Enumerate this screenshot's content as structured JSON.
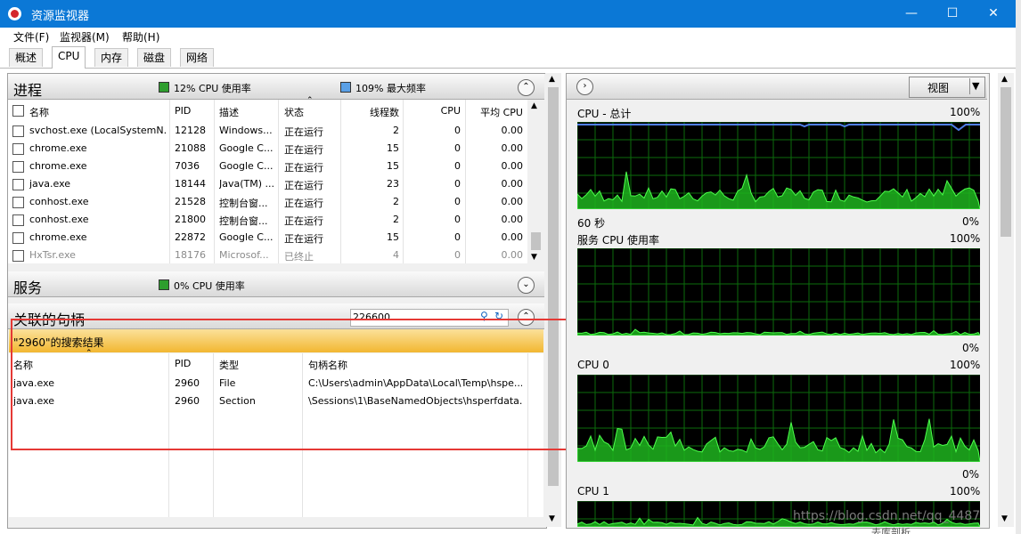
{
  "window": {
    "title": "资源监视器"
  },
  "menu": [
    {
      "label": "文件(F)"
    },
    {
      "label": "监视器(M)"
    },
    {
      "label": "帮助(H)"
    }
  ],
  "tabs": [
    {
      "label": "概述"
    },
    {
      "label": "CPU"
    },
    {
      "label": "内存"
    },
    {
      "label": "磁盘"
    },
    {
      "label": "网络"
    }
  ],
  "processes": {
    "title": "进程",
    "cpu_usage": "12% CPU 使用率",
    "max_freq": "109% 最大频率",
    "columns": [
      "名称",
      "PID",
      "描述",
      "状态",
      "线程数",
      "CPU",
      "平均 CPU"
    ],
    "rows": [
      [
        "svchost.exe (LocalSystemN...",
        "12128",
        "Windows...",
        "正在运行",
        "2",
        "0",
        "0.00"
      ],
      [
        "chrome.exe",
        "21088",
        "Google C...",
        "正在运行",
        "15",
        "0",
        "0.00"
      ],
      [
        "chrome.exe",
        "7036",
        "Google C...",
        "正在运行",
        "15",
        "0",
        "0.00"
      ],
      [
        "java.exe",
        "18144",
        "Java(TM) ...",
        "正在运行",
        "23",
        "0",
        "0.00"
      ],
      [
        "conhost.exe",
        "21528",
        "控制台窗...",
        "正在运行",
        "2",
        "0",
        "0.00"
      ],
      [
        "conhost.exe",
        "21800",
        "控制台窗...",
        "正在运行",
        "2",
        "0",
        "0.00"
      ],
      [
        "chrome.exe",
        "22872",
        "Google C...",
        "正在运行",
        "15",
        "0",
        "0.00"
      ],
      [
        "HxTsr.exe",
        "18176",
        "Microsof...",
        "已终止",
        "4",
        "0",
        "0.00"
      ]
    ],
    "colors": {
      "cpu_chip": "#2e9e2e",
      "freq_chip": "#5aa0e6"
    }
  },
  "services": {
    "title": "服务",
    "cpu_usage": "0% CPU 使用率"
  },
  "handles": {
    "title": "关联的句柄",
    "search_value": "226600",
    "result_banner": "\"2960\"的搜索结果",
    "columns": [
      "名称",
      "PID",
      "类型",
      "句柄名称"
    ],
    "rows": [
      [
        "java.exe",
        "2960",
        "File",
        "C:\\Users\\admin\\AppData\\Local\\Temp\\hspe..."
      ],
      [
        "java.exe",
        "2960",
        "Section",
        "\\Sessions\\1\\BaseNamedObjects\\hsperfdata..."
      ]
    ],
    "banner_color": "#f5c242",
    "highlight_color": "#e53935"
  },
  "right": {
    "view_label": "视图",
    "graphs": [
      {
        "title": "CPU - 总计",
        "max": "100%",
        "time": "60 秒",
        "min": "0%"
      },
      {
        "title": "服务 CPU 使用率",
        "max": "100%",
        "min": "0%"
      },
      {
        "title": "CPU 0",
        "max": "100%",
        "min": "0%"
      },
      {
        "title": "CPU 1",
        "max": "100%"
      }
    ],
    "graph_color": "#1fb41f"
  },
  "watermark": "https://blog.csdn.net/qq_4487",
  "side_text": {
    "bottom_fragment": "去库剖析"
  }
}
